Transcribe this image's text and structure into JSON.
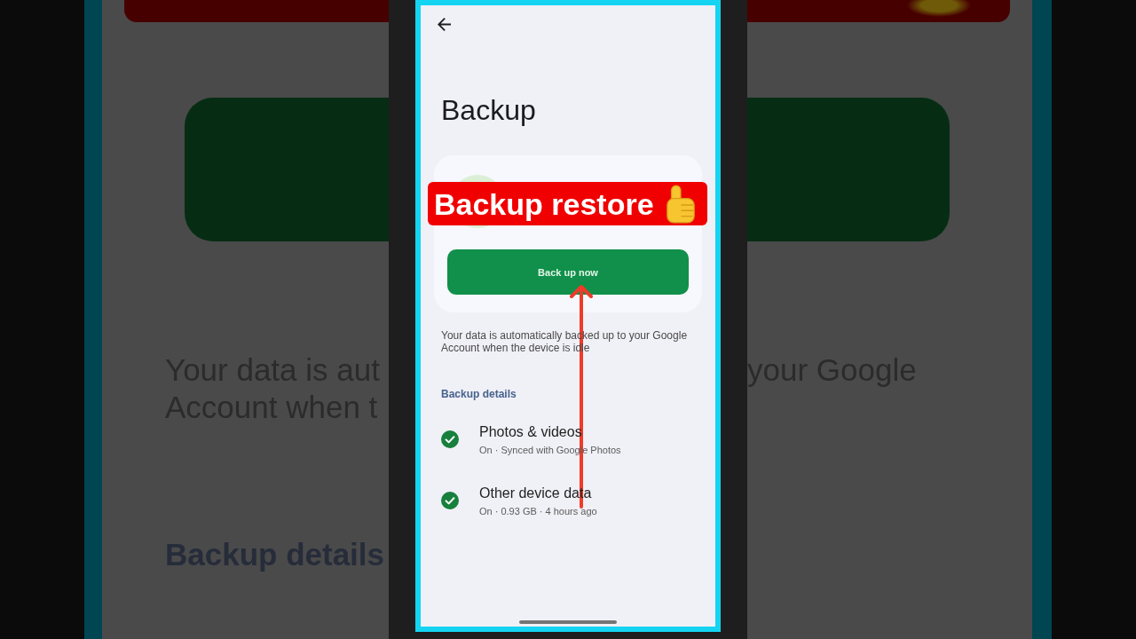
{
  "backdrop": {
    "left": {
      "lines": [
        "Your data is aut",
        "Account when t"
      ],
      "section_label": "Backup details"
    },
    "right": {
      "lines": [
        "your Google"
      ]
    }
  },
  "screen": {
    "title": "Backup",
    "card": {
      "button": "Back up now"
    },
    "description": "Your data is automatically backed up to your Google Account when the device is idle",
    "section_label": "Backup details",
    "items": [
      {
        "title": "Photos & videos",
        "subtitle": "On · Synced with Google Photos"
      },
      {
        "title": "Other device data",
        "subtitle": "On · 0.93 GB · 4 hours ago"
      }
    ]
  },
  "overlay": {
    "caption": "Backup restore"
  }
}
